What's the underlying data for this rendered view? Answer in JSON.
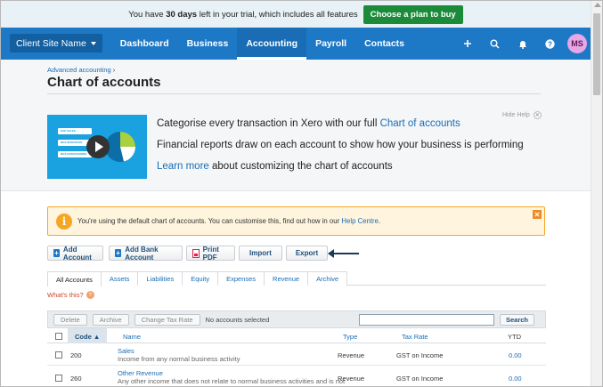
{
  "trial": {
    "prefix": "You have ",
    "days": "30 days",
    "suffix": " left in your trial, which includes all features",
    "cta": "Choose a plan to buy"
  },
  "nav": {
    "org": "Client Site Name",
    "tabs": [
      "Dashboard",
      "Business",
      "Accounting",
      "Payroll",
      "Contacts"
    ],
    "active_tab": "Accounting",
    "avatar": "MS"
  },
  "header": {
    "breadcrumb": "Advanced accounting",
    "title": "Chart of accounts",
    "hide_help": "Hide Help",
    "video_bars": [
      "EXP SALES",
      "BOX INVENTORY",
      "BOX ENTERTAINING"
    ],
    "line1_text": "Categorise every transaction in Xero with our full ",
    "line1_link": "Chart of accounts",
    "line2": "Financial reports draw on each account to show how your business is performing",
    "line3_link": "Learn more",
    "line3_text": " about customizing the chart of accounts"
  },
  "notice": {
    "text": "You're using the default chart of accounts. You can customise this, find out how in our ",
    "link": "Help Centre",
    "end": "."
  },
  "toolbar": {
    "add_account": "Add Account",
    "add_bank_account": "Add Bank Account",
    "print_pdf": "Print PDF",
    "import": "Import",
    "export": "Export"
  },
  "tabs": [
    "All Accounts",
    "Assets",
    "Liabilities",
    "Equity",
    "Expenses",
    "Revenue",
    "Archive"
  ],
  "whats_this": "What's this?",
  "table": {
    "actions": {
      "delete": "Delete",
      "archive": "Archive",
      "change_tax": "Change Tax Rate",
      "no_selection": "No accounts selected",
      "search": "Search"
    },
    "columns": {
      "code": "Code",
      "name": "Name",
      "type": "Type",
      "tax_rate": "Tax Rate",
      "ytd": "YTD"
    },
    "rows": [
      {
        "code": "200",
        "name": "Sales",
        "desc": "Income from any normal business activity",
        "type": "Revenue",
        "tax": "GST on Income",
        "ytd": "0.00"
      },
      {
        "code": "260",
        "name": "Other Revenue",
        "desc": "Any other income that does not relate to normal business activities and is not",
        "type": "Revenue",
        "tax": "GST on Income",
        "ytd": "0.00"
      }
    ]
  },
  "colors": {
    "nav": "#1d78c6",
    "cta": "#1b8b3a",
    "link": "#1a6db5",
    "notice": "#f5a623"
  }
}
